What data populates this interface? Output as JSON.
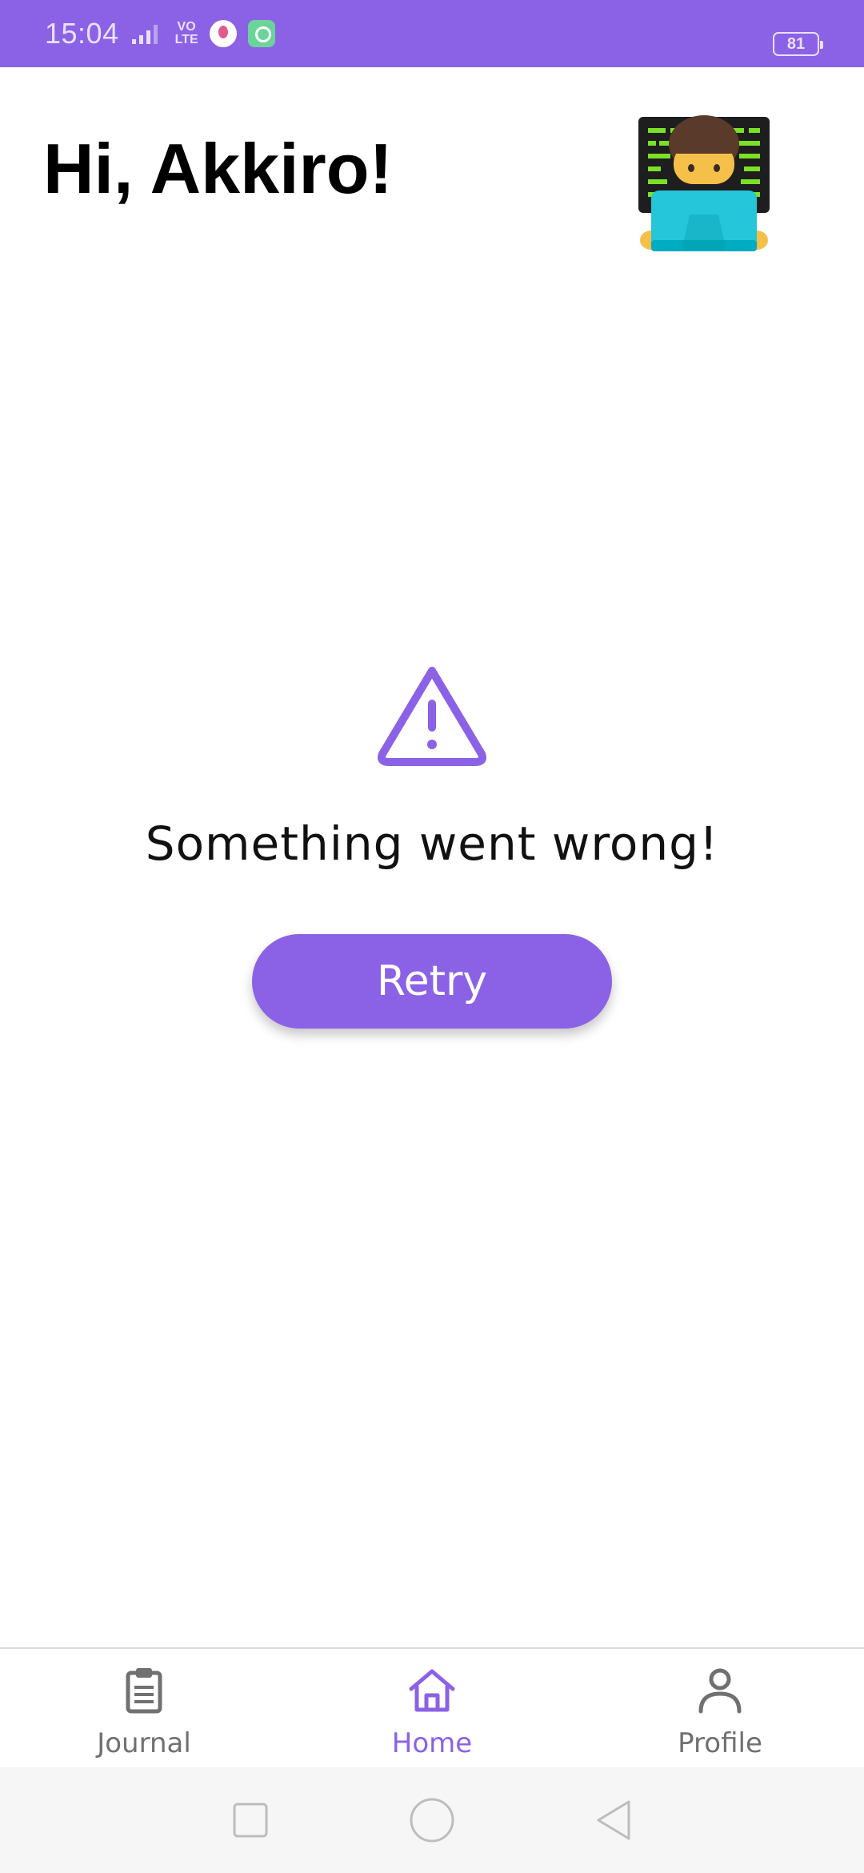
{
  "status_bar": {
    "time": "15:04",
    "network_label": "VO\nLTE",
    "battery_level": "81",
    "bg_color": "#8b62e6"
  },
  "header": {
    "greeting": "Hi, Akkiro!",
    "avatar_icon": "man-technologist-emoji"
  },
  "error_state": {
    "icon": "warning-triangle-icon",
    "message": "Something went wrong!",
    "retry_label": "Retry",
    "accent_color": "#8b62e6"
  },
  "bottom_nav": {
    "items": [
      {
        "label": "Journal",
        "icon": "clipboard-icon",
        "active": false
      },
      {
        "label": "Home",
        "icon": "home-icon",
        "active": true
      },
      {
        "label": "Profile",
        "icon": "person-icon",
        "active": false
      }
    ]
  },
  "system_nav": {
    "buttons": [
      "recents-square-icon",
      "home-circle-icon",
      "back-triangle-icon"
    ]
  }
}
